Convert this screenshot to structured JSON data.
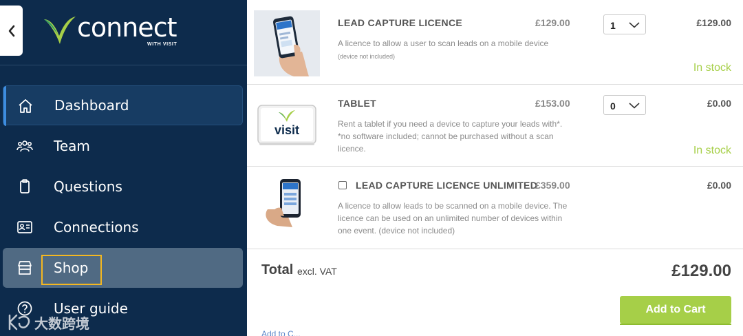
{
  "sidebar": {
    "brand": {
      "name": "connect",
      "tagline": "WITH VISIT"
    },
    "items": [
      {
        "label": "Dashboard",
        "icon": "home-icon",
        "state": "active"
      },
      {
        "label": "Team",
        "icon": "team-icon",
        "state": "default"
      },
      {
        "label": "Questions",
        "icon": "clipboard-icon",
        "state": "default"
      },
      {
        "label": "Connections",
        "icon": "contact-card-icon",
        "state": "default"
      },
      {
        "label": "Shop",
        "icon": "store-icon",
        "state": "hovered"
      },
      {
        "label": "User guide",
        "icon": "help-circle-icon",
        "state": "default"
      }
    ],
    "watermark": "大数跨境"
  },
  "products": [
    {
      "name": "LEAD CAPTURE LICENCE",
      "price": "£129.00",
      "description": "A licence to allow a user to scan leads on a mobile device",
      "note": "(device not included)",
      "quantity": "1",
      "line_total": "£129.00",
      "stock": "In stock"
    },
    {
      "name": "TABLET",
      "price": "£153.00",
      "description": "Rent a tablet if you need a device to capture your leads with*. *no software included; cannot be purchased without a scan licence.",
      "quantity": "0",
      "line_total": "£0.00",
      "stock": "In stock",
      "thumb_brand": "visit"
    },
    {
      "name": "LEAD CAPTURE LICENCE UNLIMITED",
      "price": "£359.00",
      "description": "A licence to allow leads to be scanned on a mobile device. The licence can be used on an unlimited number of devices within one event. (device not included)",
      "line_total": "£0.00",
      "checked": false
    }
  ],
  "summary": {
    "total_label": "Total",
    "total_sub": "excl. VAT",
    "total_amount": "£129.00",
    "add_to_cart": "Add to Cart",
    "link_partial": "Add to C..."
  },
  "colors": {
    "sidebar_bg": "#0d2b4c",
    "accent_green": "#a6cf48",
    "active_indicator": "#3d8de0",
    "highlight_box": "#f5b820"
  }
}
